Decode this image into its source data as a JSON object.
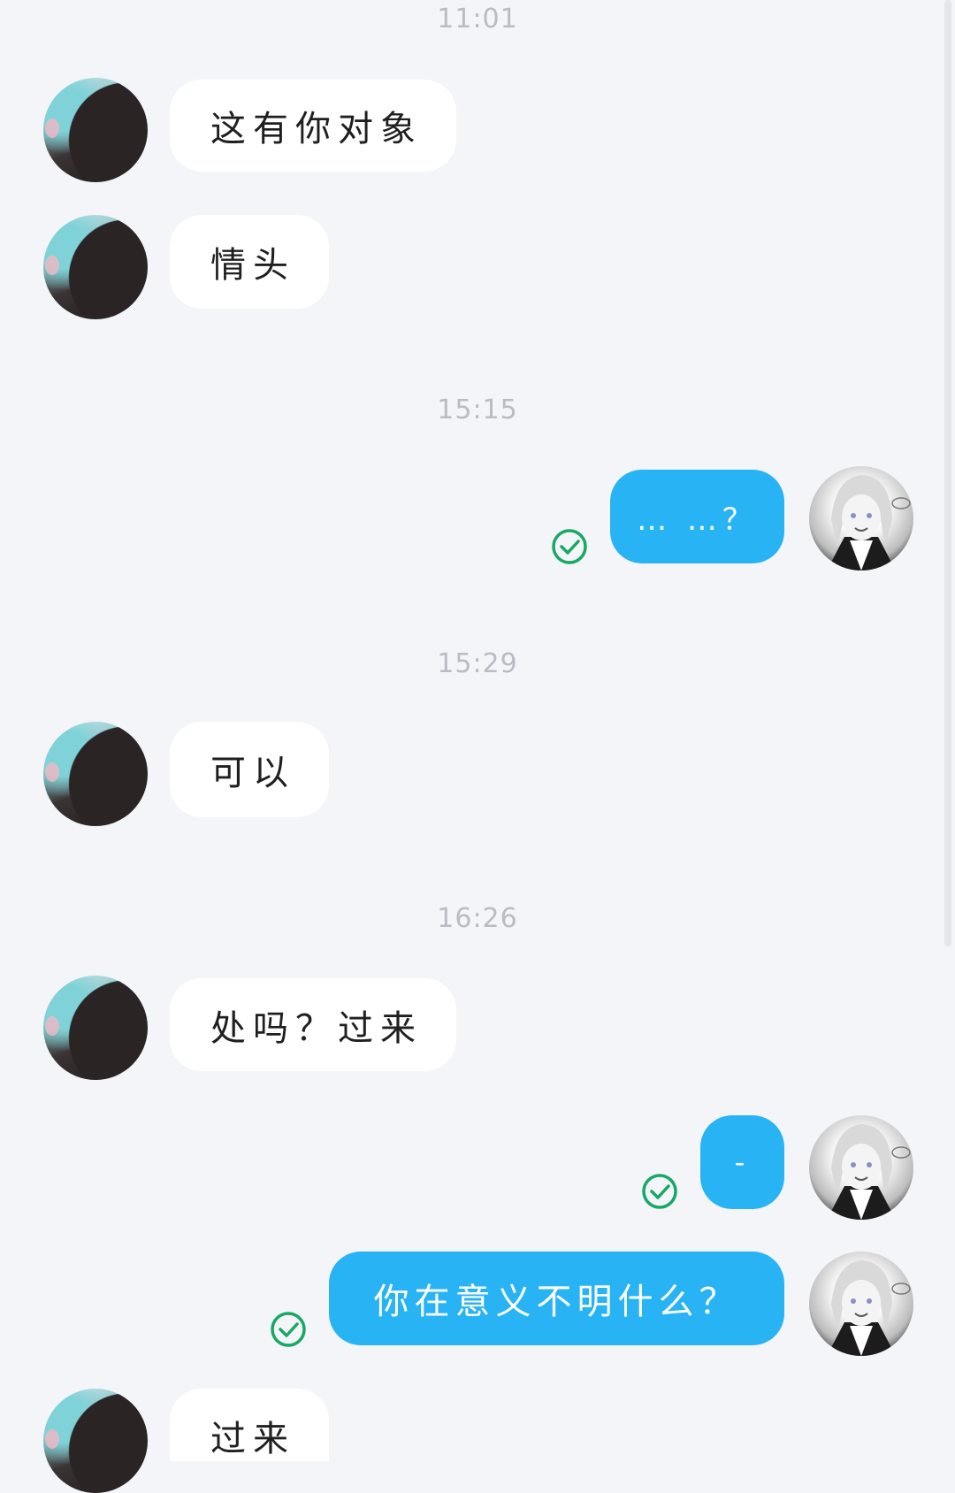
{
  "colors": {
    "background": "#f3f5f9",
    "incoming_bubble": "#ffffff",
    "outgoing_bubble": "#28b3f5",
    "read_check": "#18a865",
    "timestamp": "#b9bcc2"
  },
  "timestamps": [
    "11:01",
    "15:15",
    "15:29",
    "16:26"
  ],
  "messages": [
    {
      "direction": "incoming",
      "text": "这有你对象"
    },
    {
      "direction": "incoming",
      "text": "情头"
    },
    {
      "direction": "outgoing",
      "text": "… …？",
      "status": "read"
    },
    {
      "direction": "incoming",
      "text": "可以"
    },
    {
      "direction": "incoming",
      "text": "处吗？过来"
    },
    {
      "direction": "outgoing",
      "text": "-",
      "status": "read"
    },
    {
      "direction": "outgoing",
      "text": "你在意义不明什么？",
      "status": "read"
    },
    {
      "direction": "incoming",
      "text": "过来"
    }
  ],
  "icons": {
    "read_status": "check-circle-icon",
    "incoming_avatar": "contact-avatar",
    "outgoing_avatar": "self-avatar"
  }
}
